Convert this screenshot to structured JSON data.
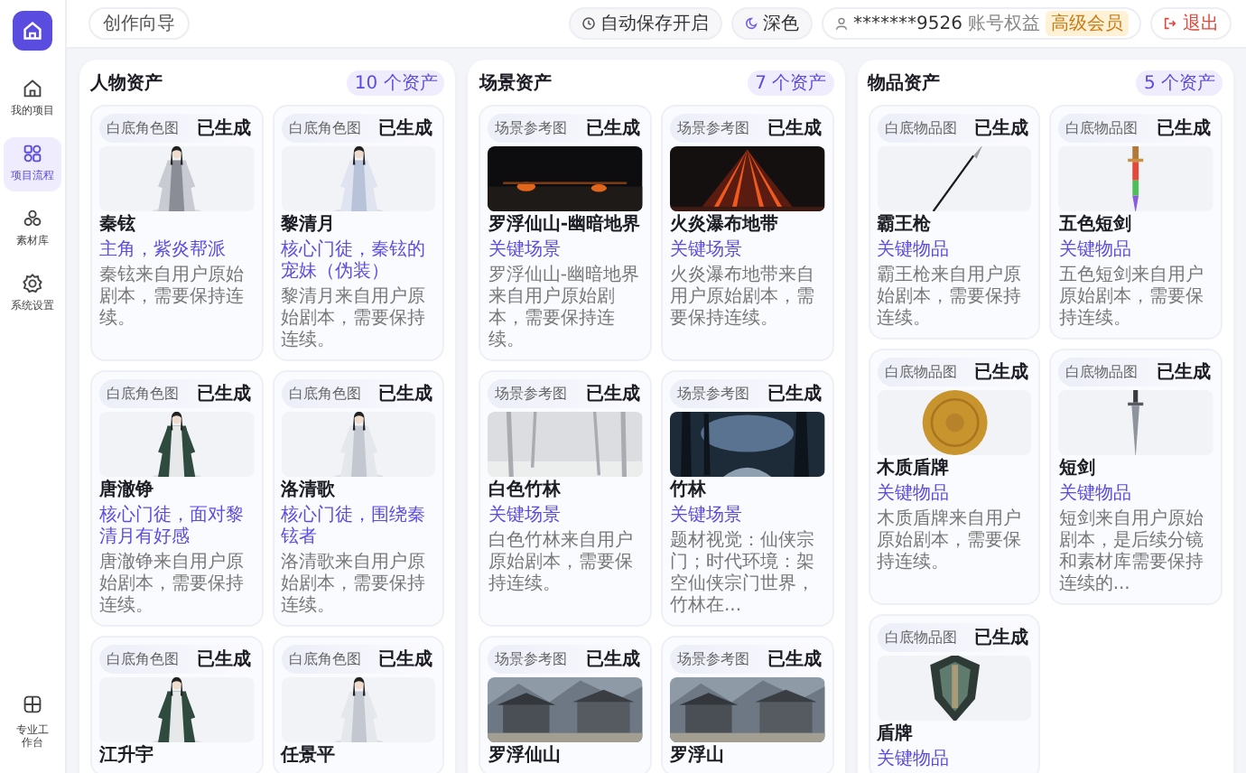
{
  "sidebar": {
    "items": [
      {
        "label": "我的项目",
        "selected": false
      },
      {
        "label": "项目流程",
        "selected": true
      },
      {
        "label": "素材库",
        "selected": false
      },
      {
        "label": "系统设置",
        "selected": false
      }
    ],
    "footer": "专业工作台"
  },
  "topbar": {
    "breadcrumb": "创作向导",
    "autosave": "自动保存开启",
    "theme": "深色",
    "user": "*******9526",
    "account": "账号权益",
    "badge": "高级会员",
    "logout": "退出"
  },
  "panels": [
    {
      "title": "人物资产",
      "count": "10 个资产",
      "cards": [
        {
          "type": "白底角色图",
          "status": "已生成",
          "name": "秦铉",
          "tag": "主角，紫炎帮派",
          "desc": "秦铉来自用户原始剧本，需要保持连续。"
        },
        {
          "type": "白底角色图",
          "status": "已生成",
          "name": "黎清月",
          "tag": "核心门徒，秦铉的宠妹（伪装）",
          "desc": "黎清月来自用户原始剧本，需要保持连续。"
        },
        {
          "type": "白底角色图",
          "status": "已生成",
          "name": "唐澈铮",
          "tag": "核心门徒，面对黎清月有好感",
          "desc": "唐澈铮来自用户原始剧本，需要保持连续。"
        },
        {
          "type": "白底角色图",
          "status": "已生成",
          "name": "洛清歌",
          "tag": "核心门徒，围绕秦铉者",
          "desc": "洛清歌来自用户原始剧本，需要保持连续。"
        },
        {
          "type": "白底角色图",
          "status": "已生成",
          "name": "江升宇"
        },
        {
          "type": "白底角色图",
          "status": "已生成",
          "name": "任景平"
        }
      ]
    },
    {
      "title": "场景资产",
      "count": "7 个资产",
      "cards": [
        {
          "type": "场景参考图",
          "status": "已生成",
          "name": "罗浮仙山-幽暗地界",
          "tag": "关键场景",
          "desc": "罗浮仙山-幽暗地界来自用户原始剧本，需要保持连续。"
        },
        {
          "type": "场景参考图",
          "status": "已生成",
          "name": "火炎瀑布地带",
          "tag": "关键场景",
          "desc": "火炎瀑布地带来自用户原始剧本，需要保持连续。"
        },
        {
          "type": "场景参考图",
          "status": "已生成",
          "name": "白色竹林",
          "tag": "关键场景",
          "desc": "白色竹林来自用户原始剧本，需要保持连续。"
        },
        {
          "type": "场景参考图",
          "status": "已生成",
          "name": "竹林",
          "tag": "关键场景",
          "desc": "题材视觉：仙侠宗门；时代环境：架空仙侠宗门世界，竹林在..."
        },
        {
          "type": "场景参考图",
          "status": "已生成",
          "name": "罗浮仙山"
        },
        {
          "type": "场景参考图",
          "status": "已生成",
          "name": "罗浮山"
        }
      ]
    },
    {
      "title": "物品资产",
      "count": "5 个资产",
      "cards": [
        {
          "type": "白底物品图",
          "status": "已生成",
          "name": "霸王枪",
          "tag": "关键物品",
          "desc": "霸王枪来自用户原始剧本，需要保持连续。"
        },
        {
          "type": "白底物品图",
          "status": "已生成",
          "name": "五色短剑",
          "tag": "关键物品",
          "desc": "五色短剑来自用户原始剧本，需要保持连续。"
        },
        {
          "type": "白底物品图",
          "status": "已生成",
          "name": "木质盾牌",
          "tag": "关键物品",
          "desc": "木质盾牌来自用户原始剧本，需要保持连续。"
        },
        {
          "type": "白底物品图",
          "status": "已生成",
          "name": "短剑",
          "tag": "关键物品",
          "desc": "短剑来自用户原始剧本，是后续分镜和素材库需要保持连续的..."
        },
        {
          "type": "白底物品图",
          "status": "已生成",
          "name": "盾牌",
          "tag": "关键物品"
        }
      ]
    }
  ]
}
